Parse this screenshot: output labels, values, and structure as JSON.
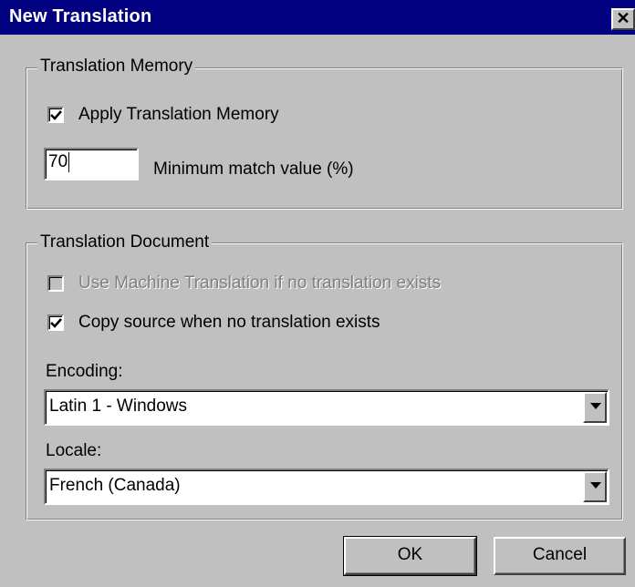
{
  "window": {
    "title": "New Translation",
    "close_glyph": "✕"
  },
  "translation_memory": {
    "group_title": "Translation Memory",
    "apply": {
      "label": "Apply Translation Memory",
      "checked": true
    },
    "min_match": {
      "value": "70",
      "label": "Minimum match value (%)"
    }
  },
  "translation_document": {
    "group_title": "Translation Document",
    "machine_translation": {
      "label": "Use Machine Translation if no translation exists",
      "checked": false,
      "disabled": true
    },
    "copy_source": {
      "label": "Copy source when no translation exists",
      "checked": true
    },
    "encoding": {
      "label": "Encoding:",
      "value": "Latin 1 - Windows"
    },
    "locale": {
      "label": "Locale:",
      "value": "French (Canada)"
    }
  },
  "buttons": {
    "ok": "OK",
    "cancel": "Cancel"
  },
  "icons": {
    "check": "check-icon",
    "dropdown": "chevron-down-icon",
    "close": "close-icon"
  },
  "colors": {
    "titlebar": "#000080",
    "dialog_face": "#c0c0c0",
    "disabled_text": "#808080"
  }
}
